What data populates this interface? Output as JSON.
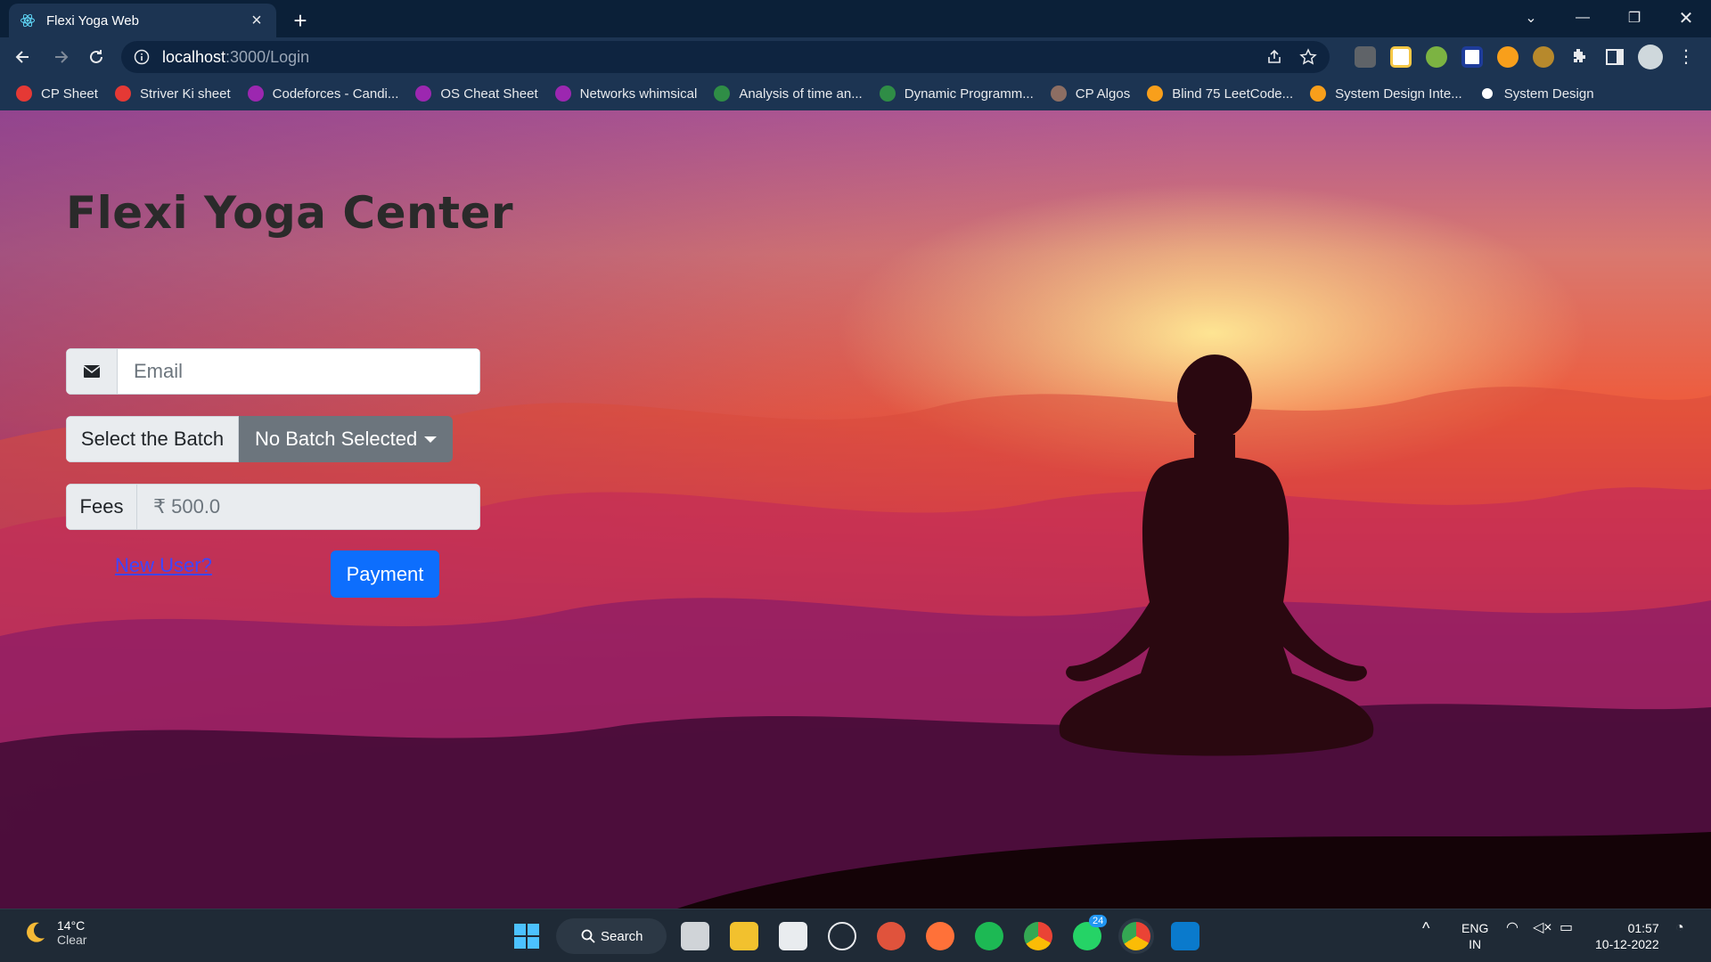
{
  "browser": {
    "tab_title": "Flexi Yoga Web",
    "url_host": "localhost",
    "url_path": ":3000/Login"
  },
  "bookmarks": [
    {
      "label": "CP Sheet",
      "icon": "tuf-icon",
      "color": "#e53935"
    },
    {
      "label": "Striver Ki sheet",
      "icon": "tuf-icon",
      "color": "#e53935"
    },
    {
      "label": "Codeforces - Candi...",
      "icon": "whimsical-icon",
      "color": "#9c27b0"
    },
    {
      "label": "OS Cheat Sheet",
      "icon": "whimsical-icon",
      "color": "#9c27b0"
    },
    {
      "label": "Networks whimsical",
      "icon": "whimsical-icon",
      "color": "#9c27b0"
    },
    {
      "label": "Analysis of time an...",
      "icon": "gfg-icon",
      "color": "#2f8d46"
    },
    {
      "label": "Dynamic Programm...",
      "icon": "gfg-icon",
      "color": "#2f8d46"
    },
    {
      "label": "CP Algos",
      "icon": "cpalgos-icon",
      "color": "#8d6e63"
    },
    {
      "label": "Blind 75 LeetCode...",
      "icon": "leetcode-icon",
      "color": "#f89f1b"
    },
    {
      "label": "System Design Inte...",
      "icon": "leetcode-icon",
      "color": "#f89f1b"
    },
    {
      "label": "System Design",
      "icon": "github-icon",
      "color": "#ffffff"
    }
  ],
  "page": {
    "brand_title": "Flexi Yoga Center",
    "email_placeholder": "Email",
    "batch_label": "Select the Batch",
    "batch_dropdown": "No Batch Selected",
    "fees_label": "Fees",
    "fees_value": "₹ 500.0",
    "new_user_link": "New User?",
    "payment_button": "Payment"
  },
  "taskbar": {
    "weather_temp": "14°C",
    "weather_desc": "Clear",
    "search_label": "Search",
    "whatsapp_badge": "24",
    "lang_top": "ENG",
    "lang_bottom": "IN",
    "time": "01:57",
    "date": "10-12-2022"
  }
}
